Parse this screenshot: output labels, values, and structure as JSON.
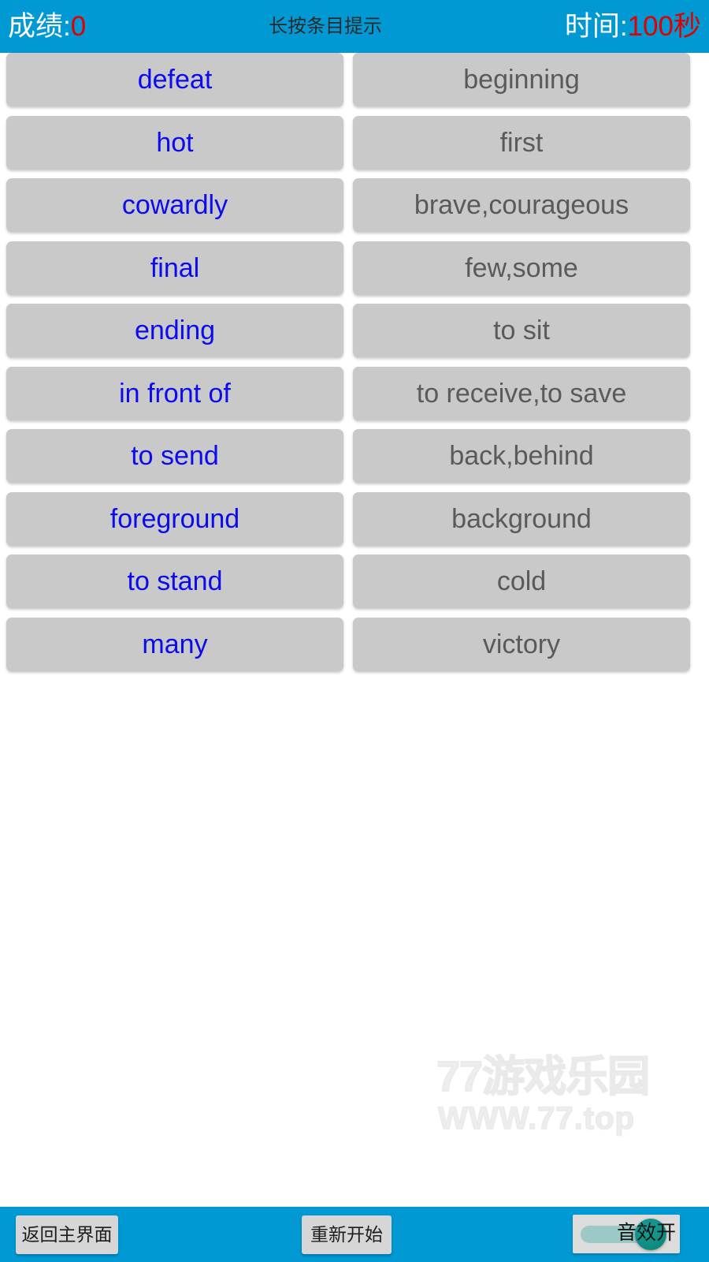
{
  "top_bar": {
    "score_label": "成绩:",
    "score_value": "0",
    "hint": "长按条目提示",
    "time_label": "时间:",
    "time_value": "100秒",
    "background_color": "#0099d4",
    "label_color": "#ffffff",
    "value_color": "#e00000",
    "hint_color": "#2a2a2a"
  },
  "board": {
    "left_text_color": "#0b0bee",
    "right_text_color": "#5a5a5a",
    "card_color": "#c9c9c9",
    "rows": [
      {
        "left": "defeat",
        "right": "beginning"
      },
      {
        "left": "hot",
        "right": "first"
      },
      {
        "left": "cowardly",
        "right": "brave,courageous"
      },
      {
        "left": "final",
        "right": "few,some"
      },
      {
        "left": "ending",
        "right": "to sit"
      },
      {
        "left": "in front of",
        "right": "to receive,to save"
      },
      {
        "left": "to send",
        "right": "back,behind"
      },
      {
        "left": "foreground",
        "right": "background"
      },
      {
        "left": "to stand",
        "right": "cold"
      },
      {
        "left": "many",
        "right": "victory"
      }
    ]
  },
  "watermark": {
    "main": "77游戏乐园",
    "sub": "WWW.77.top"
  },
  "bottom_bar": {
    "home_label": "返回主界面",
    "restart_label": "重新开始",
    "sound_label": "音效开",
    "background_color": "#0099d4",
    "button_color": "#d6d6d6",
    "switch_thumb_color": "#0d8a80",
    "switch_track_color": "#9cc9c6"
  }
}
